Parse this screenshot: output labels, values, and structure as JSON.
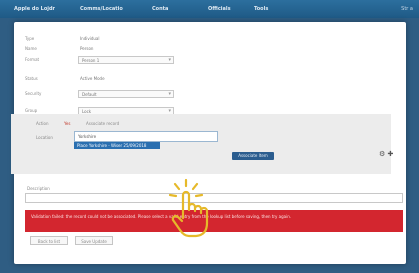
{
  "nav": [
    "Apple do Lojdr",
    "Comms/Locatio",
    "Conta",
    "Officials",
    "Tools"
  ],
  "nav_right": "Str a",
  "form": {
    "fields": [
      {
        "label": "Type",
        "value": "Individual"
      },
      {
        "label": "Name",
        "value": "Person"
      },
      {
        "label": "Format",
        "select": "Person 1"
      },
      {
        "label": "Status",
        "value": "Active Mode"
      },
      {
        "label": "Security",
        "select": "Default"
      },
      {
        "label": "Group",
        "select": "Lock"
      }
    ]
  },
  "lookup": {
    "section_label": "Action",
    "tag": "Yes",
    "desc": "Associate record",
    "row_label": "Location",
    "input_value": "Yorkshire",
    "dropdown_item": "Place Yorkshire - Wiser 25/09/2018",
    "button_label": "Associate Item",
    "tool_icons": "⚙ ✚"
  },
  "notes": {
    "label": "Description"
  },
  "error": {
    "message": "Validation failed: the record could not be associated. Please select a valid entry from the lookup list before saving, then try again."
  },
  "buttons": {
    "back": "Back to list",
    "save": "Save Update"
  },
  "colors": {
    "accent": "#2a6fb0",
    "error": "#d3262f",
    "cursor": "#e6b92a"
  }
}
